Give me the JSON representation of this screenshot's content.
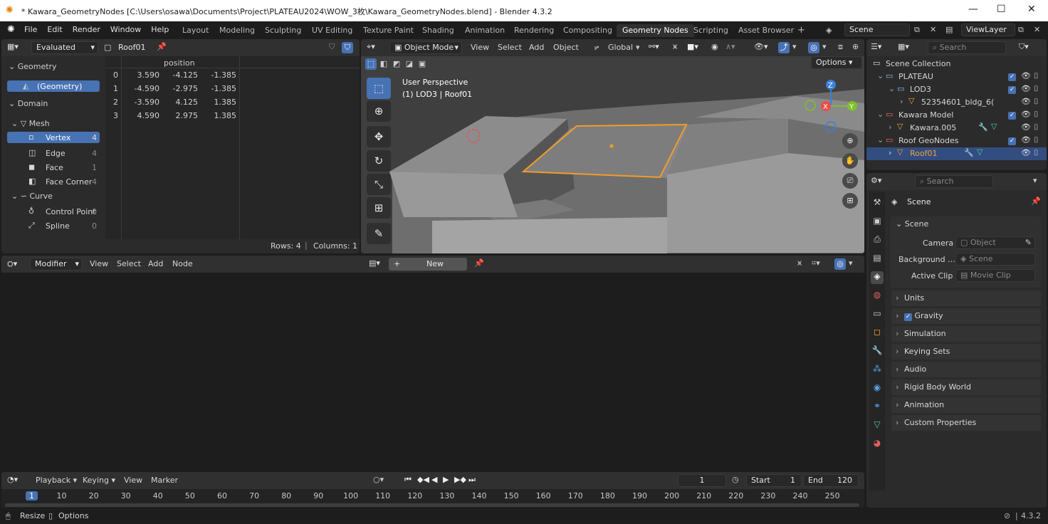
{
  "window": {
    "title": "* Kawara_GeometryNodes [C:\\Users\\osawa\\Documents\\Project\\PLATEAU2024\\WOW_3枚\\Kawara_GeometryNodes.blend] - Blender 4.3.2"
  },
  "menus": [
    "File",
    "Edit",
    "Render",
    "Window",
    "Help"
  ],
  "workspaces": [
    "Layout",
    "Modeling",
    "Sculpting",
    "UV Editing",
    "Texture Paint",
    "Shading",
    "Animation",
    "Rendering",
    "Compositing",
    "Geometry Nodes",
    "Scripting",
    "Asset Browser"
  ],
  "scene_field": "Scene",
  "view_layer_field": "ViewLayer",
  "spreadsheet": {
    "mode": "Evaluated",
    "object": "Roof01",
    "sections": {
      "geometry": "Geometry",
      "domain": "Domain"
    },
    "geometry_item": "(Geometry)",
    "mesh_label": "Mesh",
    "domains": [
      {
        "label": "Vertex",
        "count": "4"
      },
      {
        "label": "Edge",
        "count": "4"
      },
      {
        "label": "Face",
        "count": "1"
      },
      {
        "label": "Face Corner",
        "count": "4"
      }
    ],
    "curve_label": "Curve",
    "curve_domains": [
      {
        "label": "Control Point",
        "count": "0"
      },
      {
        "label": "Spline",
        "count": "0"
      }
    ],
    "column_header": "position",
    "rows": [
      {
        "i": "0",
        "x": "3.590",
        "y": "-4.125",
        "z": "-1.385"
      },
      {
        "i": "1",
        "x": "-4.590",
        "y": "-2.975",
        "z": "-1.385"
      },
      {
        "i": "2",
        "x": "-3.590",
        "y": "4.125",
        "z": "1.385"
      },
      {
        "i": "3",
        "x": "4.590",
        "y": "2.975",
        "z": "1.385"
      }
    ],
    "footer_rows": "Rows: 4",
    "footer_cols": "Columns: 1"
  },
  "viewport": {
    "mode": "Object Mode",
    "menus": [
      "View",
      "Select",
      "Add",
      "Object"
    ],
    "transform": "Global",
    "options": "Options",
    "overlay_title": "User Perspective",
    "overlay_sub": "(1) LOD3 | Roof01",
    "gizmo": {
      "x": "X",
      "y": "Y",
      "z": "Z"
    }
  },
  "node_editor": {
    "type": "Modifier",
    "menus": [
      "View",
      "Select",
      "Add",
      "Node"
    ],
    "new_button": "New"
  },
  "outliner": {
    "search_placeholder": "Search",
    "root": "Scene Collection",
    "items": [
      {
        "label": "PLATEAU"
      },
      {
        "label": "LOD3"
      },
      {
        "label": "52354601_bldg_6("
      },
      {
        "label": "Kawara Model"
      },
      {
        "label": "Kawara.005"
      },
      {
        "label": "Roof GeoNodes"
      },
      {
        "label": "Roof01"
      }
    ]
  },
  "properties": {
    "search_placeholder": "Search",
    "breadcrumb": "Scene",
    "scene_section": "Scene",
    "camera_label": "Camera",
    "camera_value": "Object",
    "background_label": "Background ...",
    "background_value": "Scene",
    "clip_label": "Active Clip",
    "clip_value": "Movie Clip",
    "panels": [
      "Units",
      "Gravity",
      "Simulation",
      "Keying Sets",
      "Audio",
      "Rigid Body World",
      "Animation",
      "Custom Properties"
    ]
  },
  "timeline": {
    "menus": [
      "Playback",
      "Keying",
      "View",
      "Marker"
    ],
    "current_frame": "1",
    "start_label": "Start",
    "start": "1",
    "end_label": "End",
    "end": "120",
    "ticks": [
      "1",
      "10",
      "20",
      "30",
      "40",
      "50",
      "60",
      "70",
      "80",
      "90",
      "100",
      "110",
      "120",
      "130",
      "140",
      "150",
      "160",
      "170",
      "180",
      "190",
      "200",
      "210",
      "220",
      "230",
      "240",
      "250"
    ]
  },
  "statusbar": {
    "resize": "Resize",
    "options": "Options",
    "version": "4.3.2"
  }
}
